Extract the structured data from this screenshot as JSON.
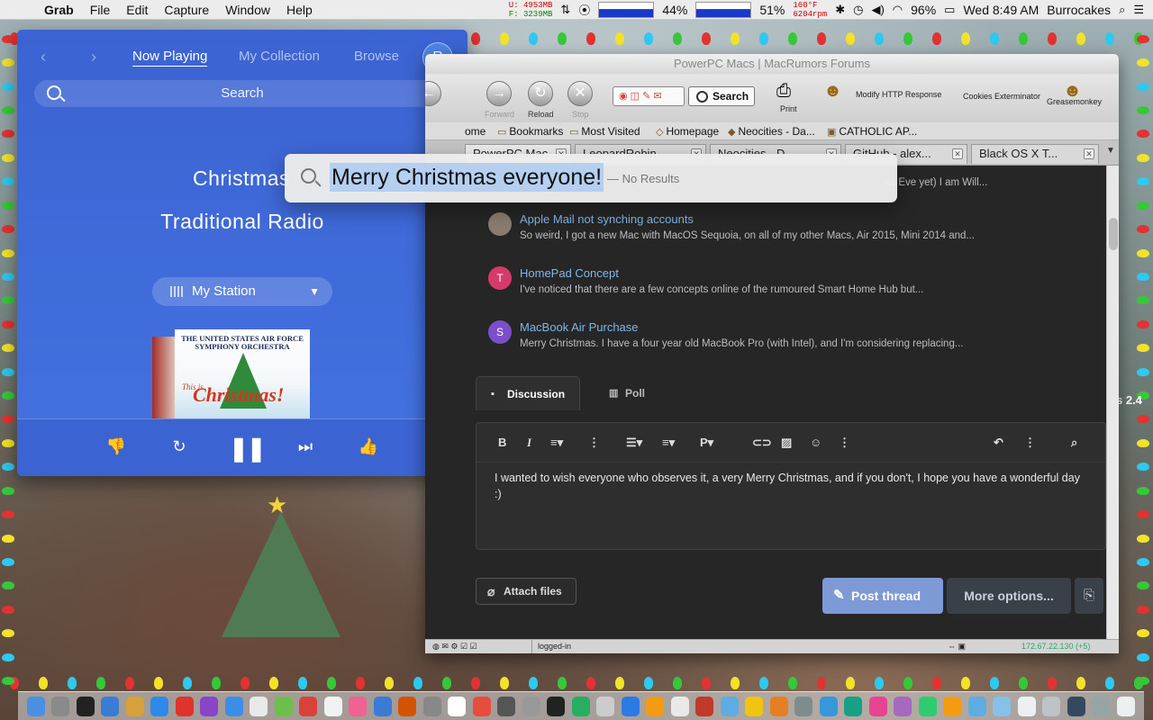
{
  "menubar": {
    "app": "Grab",
    "items": [
      "File",
      "Edit",
      "Capture",
      "Window",
      "Help"
    ],
    "mem_u": "U: 4953MB",
    "mem_f": "F: 3239MB",
    "cpu1": "44%",
    "cpu2": "51%",
    "temp": "160°F",
    "rpm": "6204rpm",
    "battery": "96%",
    "clock": "Wed 8:49 AM",
    "user": "Burrocakes"
  },
  "player": {
    "avatar_initial": "R",
    "tabs": [
      "Now Playing",
      "My Collection",
      "Browse"
    ],
    "search_label": "Search",
    "station_line1": "Christmas",
    "station_line2": "Traditional Radio",
    "station_select": "My Station",
    "album": {
      "title": "THE UNITED STATES AIR FORCE SYMPHONY ORCHESTRA",
      "this_is": "This is",
      "name": "Christmas!"
    },
    "controls": [
      "thumbs-down",
      "replay",
      "pause",
      "skip",
      "thumbs-up"
    ]
  },
  "browser": {
    "title": "PowerPC Macs | MacRumors Forums",
    "nav": {
      "forward": "Forward",
      "reload": "Reload",
      "stop": "Stop"
    },
    "search_button": "Search",
    "toolbar_items": {
      "print": "Print",
      "modify": "Modify HTTP Response",
      "cookies": "Cookies Exterminator",
      "greasemonkey": "Greasemonkey"
    },
    "bookmarks": [
      "ome",
      "Bookmarks",
      "Most Visited",
      "Homepage",
      "Neocities - Da...",
      "CATHOLIC AP..."
    ],
    "tabs": [
      "PowerPC Mac",
      "LeopardRobin",
      "Neocities - D",
      "GitHub - alex...",
      "Black OS X T..."
    ],
    "threads": [
      {
        "title": "",
        "snippet": "as Eve yet) I am Will...",
        "initial": "",
        "color": ""
      },
      {
        "title": "Apple Mail not synching accounts",
        "snippet": "So weird, I got a new Mac with MacOS Sequoia, on all of my other Macs, Air 2015, Mini 2014 and...",
        "initial": "",
        "color": "#8a7d70"
      },
      {
        "title": "HomePad Concept",
        "snippet": "I've noticed that there are a few concepts online of the rumoured Smart Home Hub but...",
        "initial": "T",
        "color": "#d63a6b"
      },
      {
        "title": "MacBook Air Purchase",
        "snippet": "Merry Christmas. I have a four year old MacBook Pro (with Intel), and I'm considering replacing...",
        "initial": "S",
        "color": "#7b4fc9"
      }
    ],
    "editor_tabs": [
      "Discussion",
      "Poll"
    ],
    "editor_text": "I wanted to wish everyone who observes it, a very Merry Christmas, and if you don't, I hope you have a wonderful day :)",
    "attach_label": "Attach files",
    "post_label": "Post thread",
    "more_label": "More options...",
    "status": {
      "login": "logged-in",
      "ip": "172.67.22.130 (+5)"
    }
  },
  "spotlight": {
    "query": "Merry Christmas everyone!",
    "hint": "— No Results"
  },
  "side_text": "s 2.4",
  "colors": {
    "player_bg": "#3b63d1",
    "link": "#7fb6ea",
    "post_button": "#7e9ad6"
  }
}
